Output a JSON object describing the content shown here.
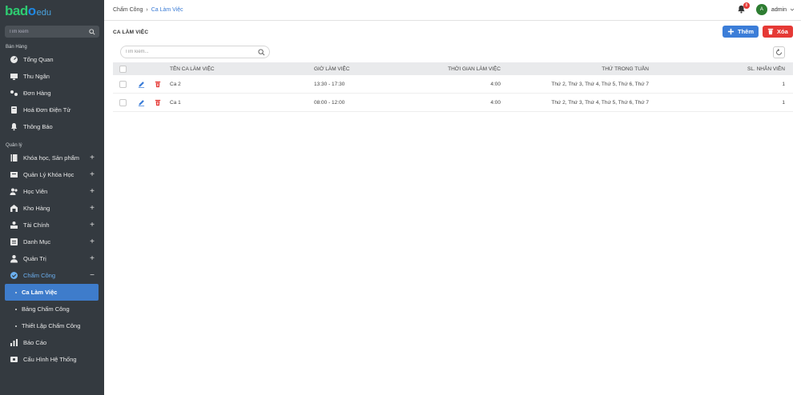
{
  "brand": {
    "logo_part1": "bad",
    "logo_part2": "o",
    "logo_suffix": "edu"
  },
  "sidebar": {
    "search_placeholder": "Tìm kiếm",
    "section_sales": "Bán Hàng",
    "sales_items": [
      {
        "label": "Tổng Quan",
        "icon": "dashboard-icon"
      },
      {
        "label": "Thu Ngân",
        "icon": "monitor-icon"
      },
      {
        "label": "Đơn Hàng",
        "icon": "order-icon"
      },
      {
        "label": "Hoá Đơn Điện Tử",
        "icon": "invoice-icon"
      },
      {
        "label": "Thông Báo",
        "icon": "bell-icon"
      }
    ],
    "section_manage": "Quản lý",
    "manage_items": [
      {
        "label": "Khóa học, Sản phẩm",
        "icon": "book-icon",
        "toggle": "+"
      },
      {
        "label": "Quản Lý Khóa Học",
        "icon": "course-icon",
        "toggle": "+"
      },
      {
        "label": "Học Viên",
        "icon": "students-icon",
        "toggle": "+"
      },
      {
        "label": "Kho Hàng",
        "icon": "warehouse-icon",
        "toggle": "+"
      },
      {
        "label": "Tài Chính",
        "icon": "finance-icon",
        "toggle": "+"
      },
      {
        "label": "Danh Mục",
        "icon": "category-icon",
        "toggle": "+"
      },
      {
        "label": "Quản Trị",
        "icon": "admin-icon",
        "toggle": "+"
      },
      {
        "label": "Chấm Công",
        "icon": "timekeeping-icon",
        "toggle": "−"
      }
    ],
    "sub_items": [
      {
        "label": "Ca Làm Việc",
        "active": true
      },
      {
        "label": "Bảng Chấm Công",
        "active": false
      },
      {
        "label": "Thiết Lập Chấm Công",
        "active": false
      }
    ],
    "bottom_items": [
      {
        "label": "Báo Cáo",
        "icon": "chart-icon"
      },
      {
        "label": "Cấu Hình Hệ Thống",
        "icon": "settings-icon"
      }
    ]
  },
  "header": {
    "breadcrumb_parent": "Chấm Công",
    "breadcrumb_sep": "›",
    "breadcrumb_current": "Ca Làm Việc",
    "notification_count": "8",
    "avatar_letter": "A",
    "username": "admin"
  },
  "main": {
    "title": "CA LÀM VIỆC",
    "add_label": "Thêm",
    "delete_label": "Xóa",
    "search_placeholder": "Tìm kiếm...",
    "columns": [
      "TÊN CA LÀM VIỆC",
      "GIỜ LÀM VIỆC",
      "THỜI GIAN LÀM VIỆC",
      "THỨ TRONG TUẦN",
      "SL. NHÂN VIÊN"
    ],
    "rows": [
      {
        "name": "Ca 2",
        "hours": "13:30 - 17:30",
        "duration": "4:00",
        "days": "Thứ 2, Thứ 3, Thứ 4, Thứ 5, Thứ 6, Thứ 7",
        "count": "1"
      },
      {
        "name": "Ca 1",
        "hours": "08:00 - 12:00",
        "duration": "4:00",
        "days": "Thứ 2, Thứ 3, Thứ 4, Thứ 5, Thứ 6, Thứ 7",
        "count": "1"
      }
    ]
  },
  "colors": {
    "sidebar_bg": "#343a40",
    "accent": "#3b7dd8",
    "danger": "#e53935",
    "active_item": "#3e7ccb"
  }
}
